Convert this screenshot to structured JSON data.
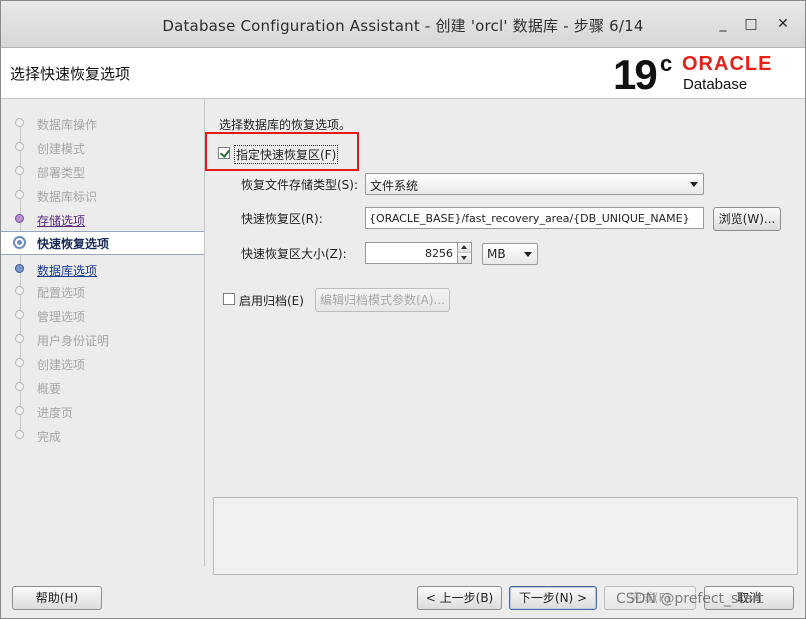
{
  "window": {
    "title": "Database Configuration Assistant - 创建 'orcl' 数据库 - 步骤 6/14",
    "minimize_glyph": "_",
    "maximize_glyph": "□",
    "close_glyph": "✕"
  },
  "header": {
    "page_title": "选择快速恢复选项",
    "logo": {
      "version": "19",
      "version_sup": "c",
      "brand": "ORACLE",
      "brand_mark": "®",
      "product": "Database"
    }
  },
  "sidebar": {
    "steps": [
      {
        "label": "数据库操作",
        "state": "disabled"
      },
      {
        "label": "创建模式",
        "state": "disabled"
      },
      {
        "label": "部署类型",
        "state": "disabled"
      },
      {
        "label": "数据库标识",
        "state": "disabled"
      },
      {
        "label": "存储选项",
        "state": "visited"
      },
      {
        "label": "快速恢复选项",
        "state": "current"
      },
      {
        "label": "数据库选项",
        "state": "link"
      },
      {
        "label": "配置选项",
        "state": "disabled"
      },
      {
        "label": "管理选项",
        "state": "disabled"
      },
      {
        "label": "用户身份证明",
        "state": "disabled"
      },
      {
        "label": "创建选项",
        "state": "disabled"
      },
      {
        "label": "概要",
        "state": "disabled"
      },
      {
        "label": "进度页",
        "state": "disabled"
      },
      {
        "label": "完成",
        "state": "disabled"
      }
    ]
  },
  "main": {
    "intro": "选择数据库的恢复选项。",
    "fra_checkbox": {
      "label": "指定快速恢复区(F)",
      "checked": true
    },
    "storage_type": {
      "label": "恢复文件存储类型(S):",
      "value": "文件系统"
    },
    "fra_location": {
      "label": "快速恢复区(R):",
      "value": "{ORACLE_BASE}/fast_recovery_area/{DB_UNIQUE_NAME}",
      "browse_label": "浏览(W)..."
    },
    "fra_size": {
      "label": "快速恢复区大小(Z):",
      "value": "8256",
      "unit": "MB"
    },
    "archive_checkbox": {
      "label": "启用归档(E)",
      "checked": false
    },
    "archive_params_button": "编辑归档模式参数(A)..."
  },
  "footer": {
    "help": "帮助(H)",
    "back": "< 上一步(B)",
    "next": "下一步(N) >",
    "finish": "完成(F)",
    "cancel": "取消"
  },
  "watermark": "CSDN @prefect_start",
  "colors": {
    "highlight_box": "#e01b1b",
    "oracle_red": "#e2231a"
  }
}
